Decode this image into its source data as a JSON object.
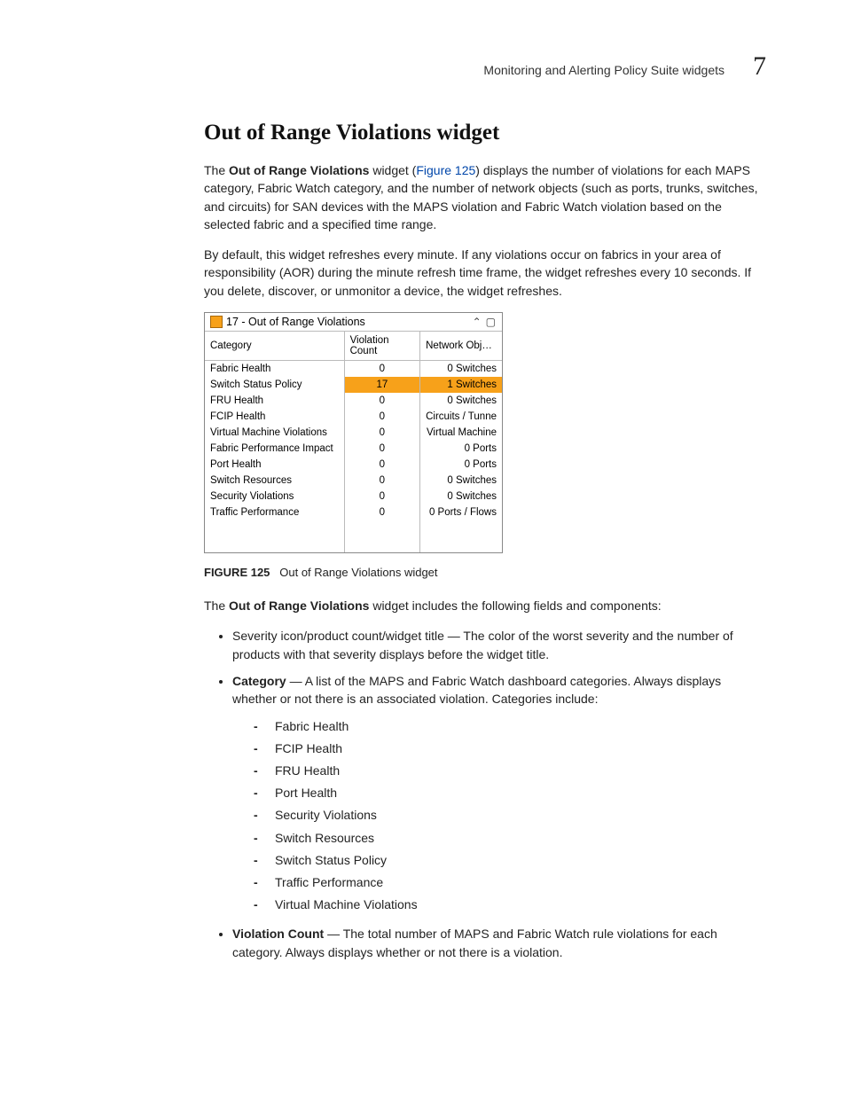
{
  "header": {
    "running": "Monitoring and Alerting Policy Suite widgets",
    "chapter": "7"
  },
  "section_title": "Out of Range Violations widget",
  "para1": {
    "lead": "The ",
    "bold": "Out of Range Violations",
    "mid": " widget (",
    "link": "Figure 125",
    "tail": ") displays the number of violations for each MAPS category, Fabric Watch category, and the number of network objects (such as ports, trunks, switches, and circuits) for SAN devices with the MAPS violation and Fabric Watch violation based on the selected fabric and a specified time range."
  },
  "para2": "By default, this widget refreshes every minute. If any violations occur on fabrics in your area of responsibility (AOR) during the minute refresh time frame, the widget refreshes every 10 seconds. If you delete, discover, or unmonitor a device, the widget refreshes.",
  "widget": {
    "title": "17 - Out of Range Violations",
    "columns": [
      "Category",
      "Violation Count",
      "Network Obj…"
    ],
    "rows": [
      {
        "category": "Fabric Health",
        "count": "0",
        "obj": "0 Switches",
        "hl": false
      },
      {
        "category": "Switch Status Policy",
        "count": "17",
        "obj": "1 Switches",
        "hl": true
      },
      {
        "category": "FRU Health",
        "count": "0",
        "obj": "0 Switches",
        "hl": false
      },
      {
        "category": "FCIP Health",
        "count": "0",
        "obj": "Circuits / Tunne",
        "hl": false
      },
      {
        "category": "Virtual Machine Violations",
        "count": "0",
        "obj": "Virtual Machine",
        "hl": false
      },
      {
        "category": "Fabric Performance Impact",
        "count": "0",
        "obj": "0 Ports",
        "hl": false
      },
      {
        "category": "Port Health",
        "count": "0",
        "obj": "0 Ports",
        "hl": false
      },
      {
        "category": "Switch Resources",
        "count": "0",
        "obj": "0 Switches",
        "hl": false
      },
      {
        "category": "Security Violations",
        "count": "0",
        "obj": "0 Switches",
        "hl": false
      },
      {
        "category": "Traffic Performance",
        "count": "0",
        "obj": "0 Ports / Flows",
        "hl": false
      }
    ]
  },
  "figure_caption": {
    "label": "FIGURE 125",
    "text": "Out of Range Violations widget"
  },
  "para3": {
    "lead": "The ",
    "bold": "Out of Range Violations",
    "tail": " widget includes the following fields and components:"
  },
  "bullets": {
    "b1": "Severity icon/product count/widget title — The color of the worst severity and the number of products with that severity displays before the widget title.",
    "b2": {
      "bold": "Category",
      "text": " — A list of the MAPS and Fabric Watch dashboard categories. Always displays whether or not there is an associated violation. Categories include:",
      "dashes": [
        "Fabric Health",
        "FCIP Health",
        "FRU Health",
        "Port Health",
        "Security Violations",
        "Switch Resources",
        "Switch Status Policy",
        "Traffic Performance",
        "Virtual Machine Violations"
      ]
    },
    "b3": {
      "bold": "Violation Count",
      "text": " — The total number of MAPS and Fabric Watch rule violations for each category. Always displays whether or not there is a violation."
    }
  }
}
